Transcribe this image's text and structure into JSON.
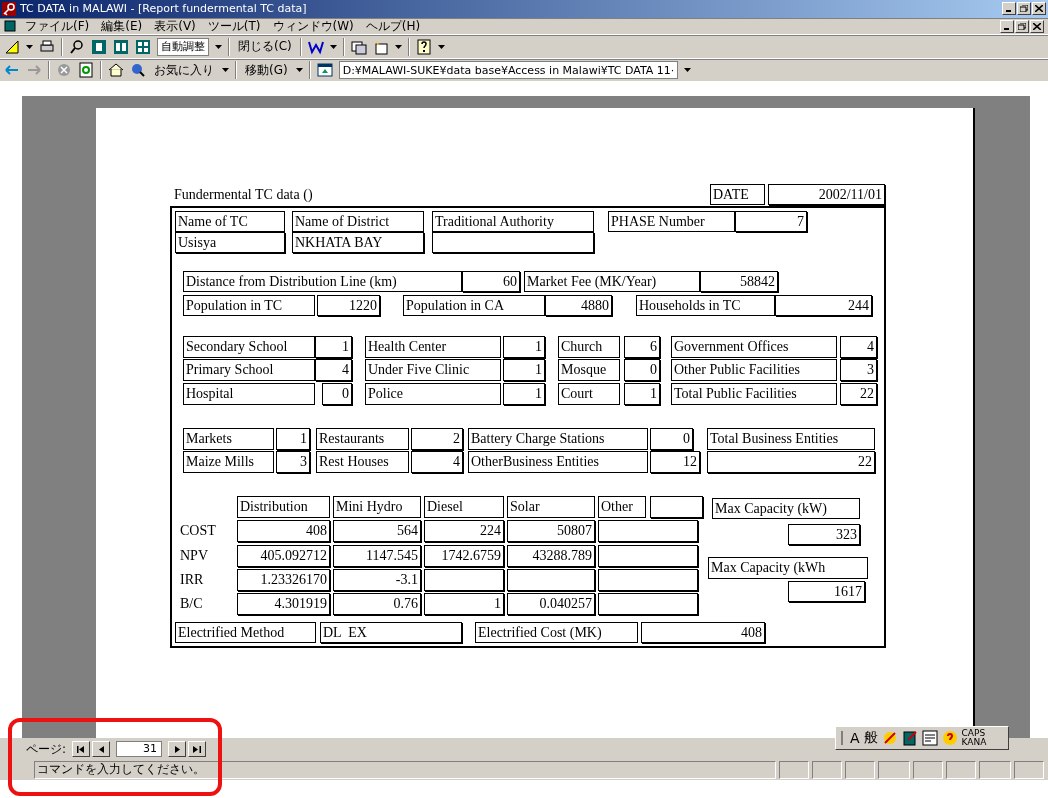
{
  "window": {
    "title": "TC DATA in MALAWI - [Report fundermental TC data]"
  },
  "menu": [
    "ファイル(F)",
    "編集(E)",
    "表示(V)",
    "ツール(T)",
    "ウィンドウ(W)",
    "ヘルプ(H)"
  ],
  "toolbar": {
    "zoom": "自動調整",
    "close": "閉じる(C)"
  },
  "web_toolbar": {
    "favorites": "お気に入り",
    "go": "移動(G)",
    "address": "D:¥MALAWI-SUKE¥data base¥Access in Malawi¥TC DATA 11·"
  },
  "report": {
    "title": "Fundermental TC data ()",
    "date_label": "DATE",
    "date": "2002/11/01",
    "controls": [
      {
        "kind": "label",
        "text": "Name of TC"
      },
      {
        "kind": "label",
        "text": "Name of District"
      },
      {
        "kind": "label",
        "text": "Traditional Authority"
      },
      {
        "kind": "label",
        "text": "PHASE Number"
      },
      {
        "kind": "value",
        "text": "7"
      },
      {
        "kind": "entry",
        "text": "Usisya"
      },
      {
        "kind": "entry",
        "text": "NKHATA BAY"
      },
      {
        "kind": "box"
      },
      {
        "kind": "label",
        "text": "Distance from Distribution Line (km)"
      },
      {
        "kind": "value",
        "text": "60"
      },
      {
        "kind": "label",
        "text": "Market Fee (MK/Year)"
      },
      {
        "kind": "value",
        "text": "58842"
      },
      {
        "kind": "label",
        "text": "Population in TC"
      },
      {
        "kind": "value",
        "text": "1220"
      },
      {
        "kind": "label",
        "text": "Population in CA"
      },
      {
        "kind": "value",
        "text": "4880"
      },
      {
        "kind": "label",
        "text": "Households in TC"
      },
      {
        "kind": "value",
        "text": "244"
      },
      {
        "kind": "label",
        "text": "Secondary School"
      },
      {
        "kind": "value",
        "text": "1"
      },
      {
        "kind": "label",
        "text": "Health Center"
      },
      {
        "kind": "value",
        "text": "1"
      },
      {
        "kind": "label",
        "text": "Church"
      },
      {
        "kind": "value",
        "text": "6"
      },
      {
        "kind": "label",
        "text": "Government Offices"
      },
      {
        "kind": "value",
        "text": "4"
      },
      {
        "kind": "label",
        "text": "Primary School"
      },
      {
        "kind": "value",
        "text": "4"
      },
      {
        "kind": "label",
        "text": "Under Five Clinic"
      },
      {
        "kind": "value",
        "text": "1"
      },
      {
        "kind": "label",
        "text": "Mosque"
      },
      {
        "kind": "value",
        "text": "0"
      },
      {
        "kind": "label",
        "text": "Other Public Facilities"
      },
      {
        "kind": "value",
        "text": "3"
      },
      {
        "kind": "label",
        "text": "Hospital"
      },
      {
        "kind": "value",
        "text": "0"
      },
      {
        "kind": "label",
        "text": "Police"
      },
      {
        "kind": "value",
        "text": "1"
      },
      {
        "kind": "label",
        "text": "Court"
      },
      {
        "kind": "value",
        "text": "1"
      },
      {
        "kind": "label",
        "text": "Total Public Facilities"
      },
      {
        "kind": "value",
        "text": "22"
      },
      {
        "kind": "label",
        "text": "Markets"
      },
      {
        "kind": "value",
        "text": "1"
      },
      {
        "kind": "label",
        "text": "Restaurants"
      },
      {
        "kind": "value",
        "text": "2"
      },
      {
        "kind": "label",
        "text": "Battery Charge Stations"
      },
      {
        "kind": "value",
        "text": "0"
      },
      {
        "kind": "label",
        "text": "Total Business Entities"
      },
      {
        "kind": "label",
        "text": "Maize Mills"
      },
      {
        "kind": "value",
        "text": "3"
      },
      {
        "kind": "label",
        "text": "Rest Houses"
      },
      {
        "kind": "value",
        "text": "4"
      },
      {
        "kind": "label",
        "text": "OtherBusiness Entities"
      },
      {
        "kind": "value",
        "text": "12"
      },
      {
        "kind": "value",
        "text": "22"
      },
      {
        "kind": "label",
        "text": "Distribution"
      },
      {
        "kind": "label",
        "text": "Mini Hydro"
      },
      {
        "kind": "label",
        "text": "Diesel"
      },
      {
        "kind": "label",
        "text": "Solar"
      },
      {
        "kind": "label",
        "text": "Other"
      },
      {
        "kind": "box"
      },
      {
        "kind": "text",
        "text": "COST"
      },
      {
        "kind": "value",
        "text": "408"
      },
      {
        "kind": "value",
        "text": "564"
      },
      {
        "kind": "value",
        "text": "224"
      },
      {
        "kind": "value",
        "text": "50807"
      },
      {
        "kind": "box"
      },
      {
        "kind": "text",
        "text": "NPV"
      },
      {
        "kind": "value",
        "text": "405.092712"
      },
      {
        "kind": "value",
        "text": "1147.545"
      },
      {
        "kind": "value",
        "text": "1742.6759"
      },
      {
        "kind": "value",
        "text": "43288.789"
      },
      {
        "kind": "box"
      },
      {
        "kind": "text",
        "text": "IRR"
      },
      {
        "kind": "value",
        "text": "1.23326170"
      },
      {
        "kind": "value",
        "text": "-3.1"
      },
      {
        "kind": "box"
      },
      {
        "kind": "box"
      },
      {
        "kind": "box"
      },
      {
        "kind": "text",
        "text": "B/C"
      },
      {
        "kind": "value",
        "text": "4.301919"
      },
      {
        "kind": "value",
        "text": "0.76"
      },
      {
        "kind": "value",
        "text": "1"
      },
      {
        "kind": "value",
        "text": "0.040257"
      },
      {
        "kind": "box"
      },
      {
        "kind": "label",
        "text": "Max Capacity (kW)"
      },
      {
        "kind": "value",
        "text": "323"
      },
      {
        "kind": "label",
        "text": "Max Capacity (kWh"
      },
      {
        "kind": "value",
        "text": "1617"
      },
      {
        "kind": "label",
        "text": "Electrified Method"
      },
      {
        "kind": "entry",
        "text": "DL  EX"
      },
      {
        "kind": "label",
        "text": "Electrified Cost (MK)"
      },
      {
        "kind": "value",
        "text": "408"
      }
    ]
  },
  "navigation": {
    "label": "ページ:",
    "page": "31"
  },
  "status_bar": {
    "message": "コマンドを入力してください。"
  },
  "language_bar": {
    "mode": "A",
    "input": "般",
    "caps": "CAPS",
    "kana": "KANA"
  }
}
